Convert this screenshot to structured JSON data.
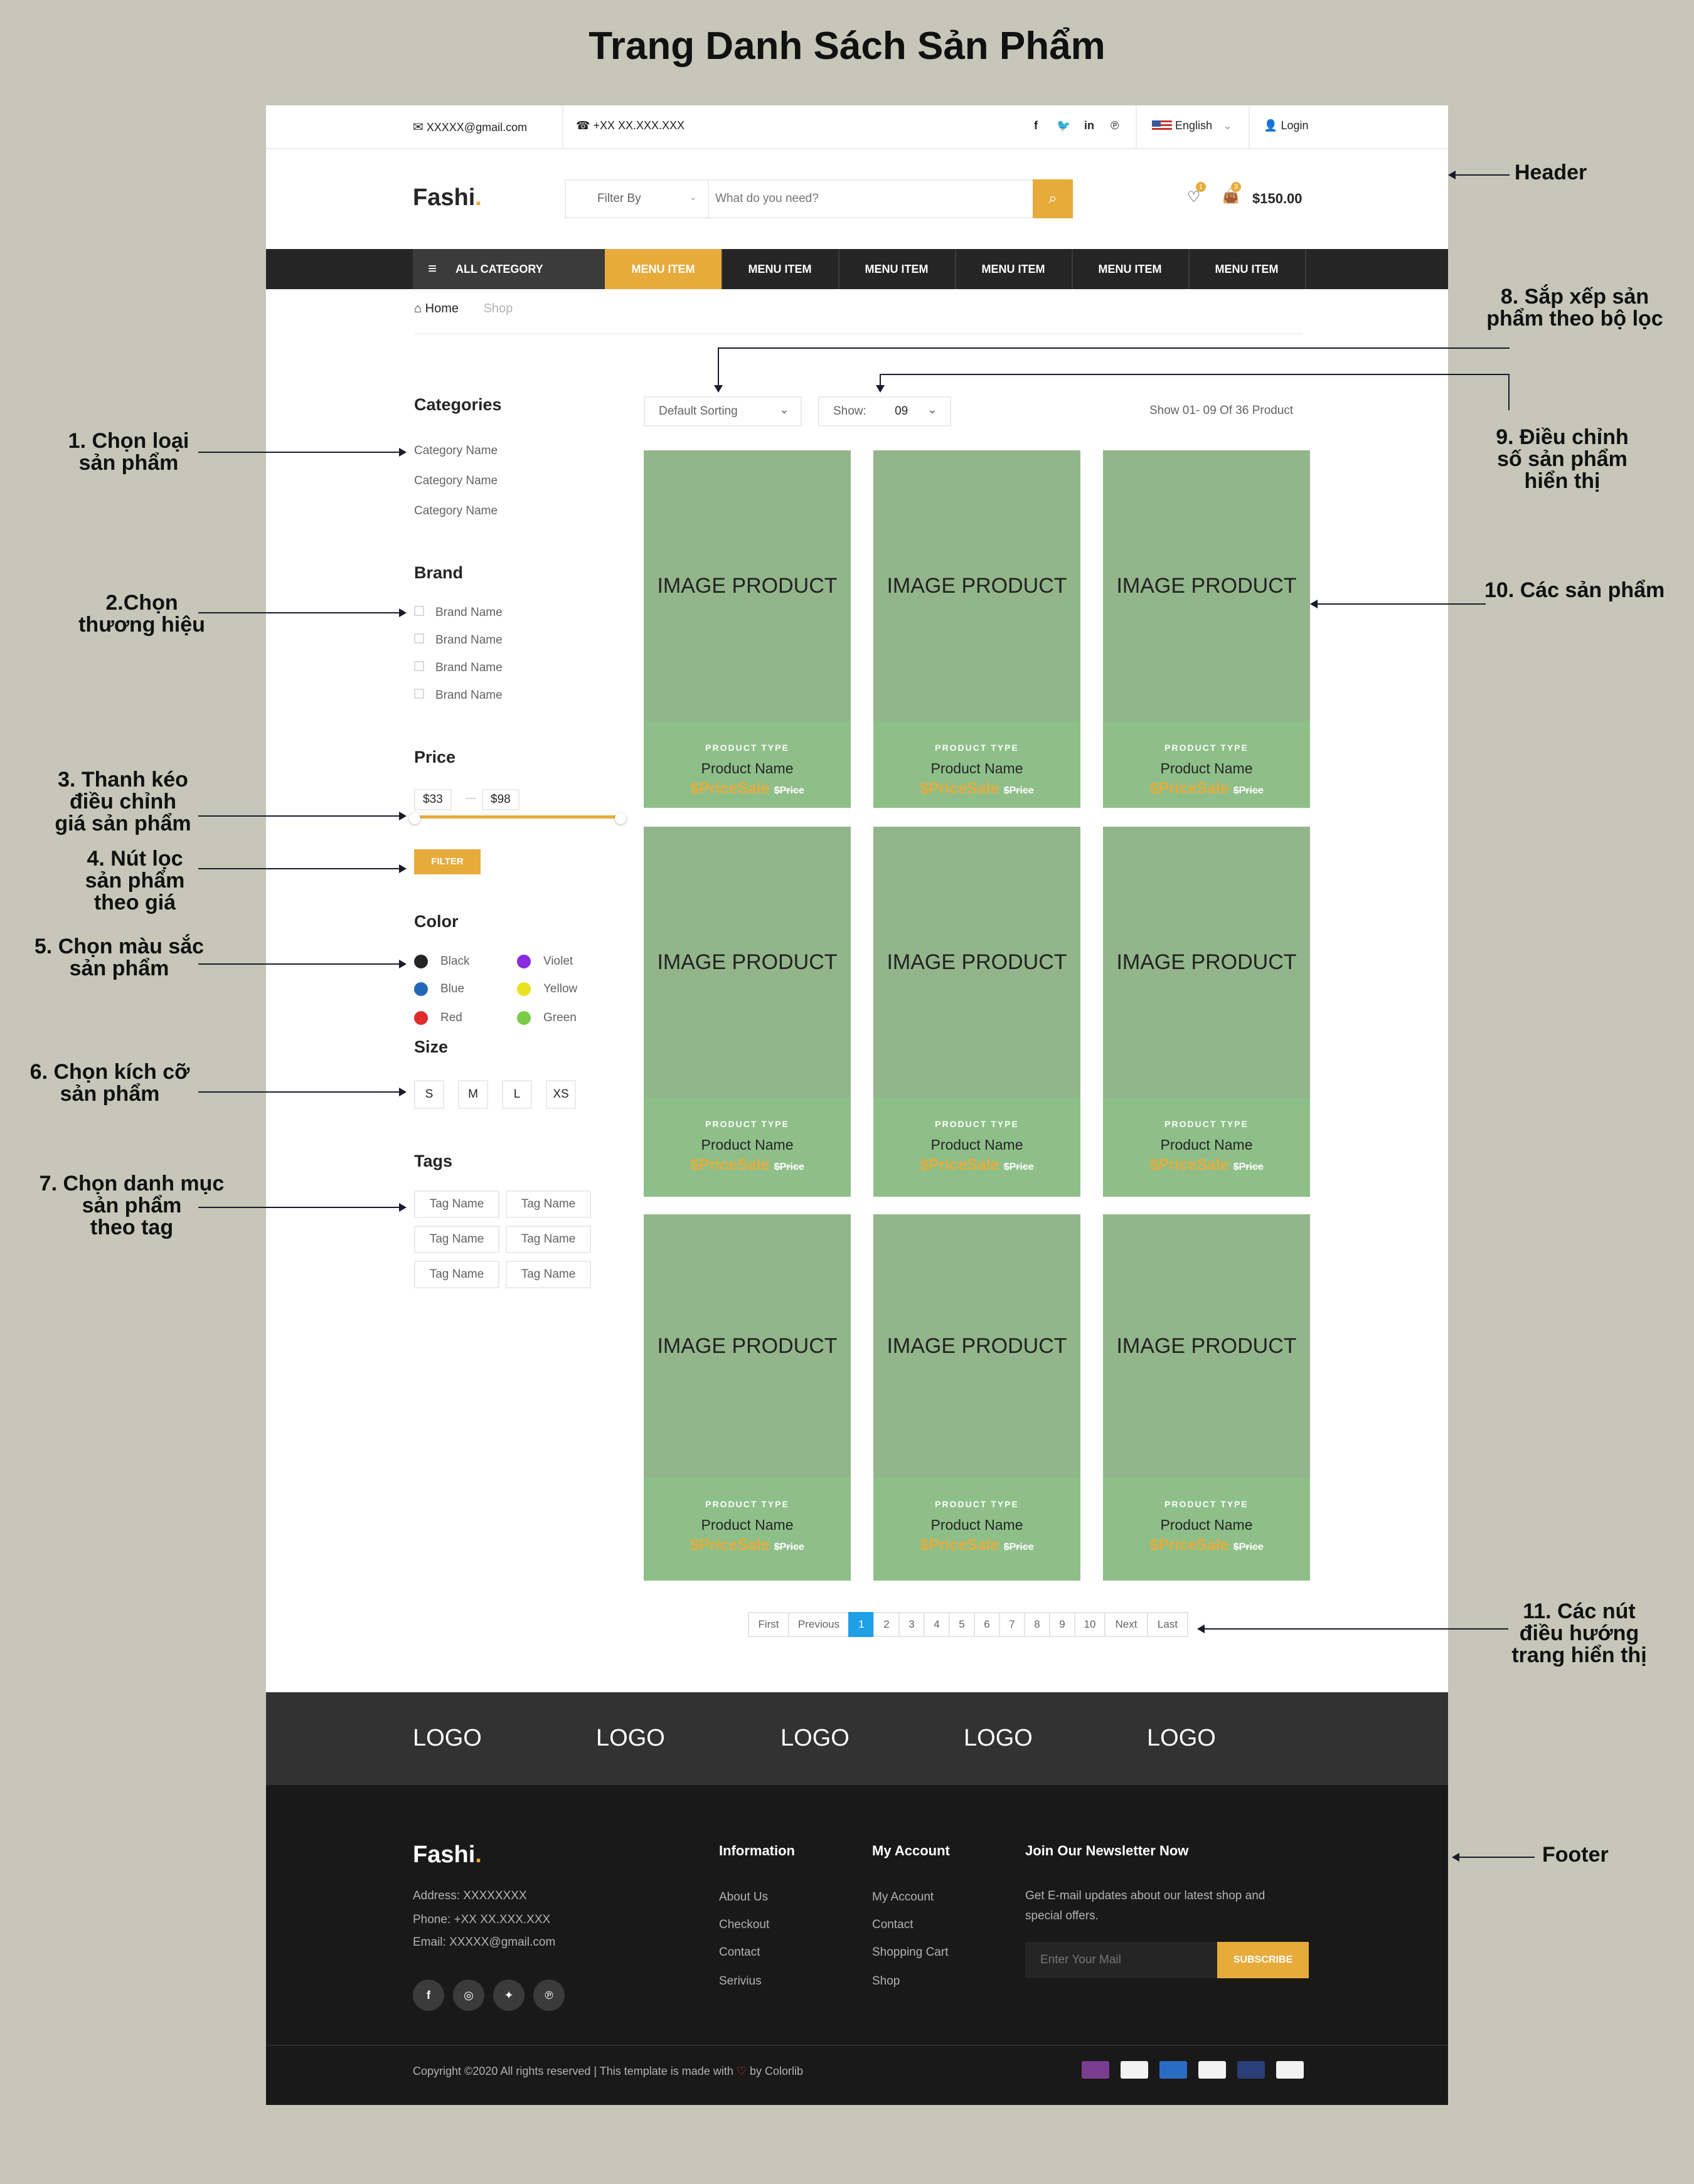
{
  "page_title": "Trang Danh Sách Sản Phẩm",
  "annotations": {
    "header": "Header",
    "filter_sort": [
      "8. Sắp xếp sản",
      "phẩm theo bộ lọc"
    ],
    "adjust_count": [
      "9. Điều chỉnh",
      "số sản phẩm",
      "hiển thị"
    ],
    "categories": [
      "1. Chọn loại",
      "sản phẩm"
    ],
    "brand": [
      "2.Chọn",
      "thương hiệu"
    ],
    "products": "10. Các sản phẩm",
    "price_slider": [
      "3. Thanh kéo",
      "điều chỉnh",
      "giá sản phẩm"
    ],
    "filter_button": [
      "4. Nút lọc",
      "sản phẩm",
      "theo giá"
    ],
    "color": [
      "5. Chọn màu sắc",
      "sản phẩm"
    ],
    "size": [
      "6. Chọn kích cỡ",
      "sản phẩm"
    ],
    "tags": [
      "7. Chọn danh mục",
      "sản phẩm",
      "theo tag"
    ],
    "pagination": [
      "11. Các nút",
      "điều hướng",
      "trang hiển thị"
    ],
    "footer": "Footer"
  },
  "topbar": {
    "email": "XXXXX@gmail.com",
    "phone": "+XX XX.XXX.XXX",
    "language": "English",
    "login": "Login"
  },
  "header": {
    "logo": "Fashi",
    "logo_dot": ".",
    "filter_label": "Filter By",
    "search_placeholder": "What do you need?",
    "wishlist_count": "1",
    "cart_count": "3",
    "cart_total": "$150.00"
  },
  "nav": {
    "all_category": "ALL CATEGORY",
    "items": [
      "MENU ITEM",
      "MENU ITEM",
      "MENU ITEM",
      "MENU ITEM",
      "MENU ITEM",
      "MENU ITEM"
    ]
  },
  "breadcrumb": {
    "home": "Home",
    "current": "Shop"
  },
  "sidebar": {
    "categories_title": "Categories",
    "categories": [
      "Category Name",
      "Category Name",
      "Category Name"
    ],
    "brand_title": "Brand",
    "brands": [
      "Brand Name",
      "Brand Name",
      "Brand Name",
      "Brand Name"
    ],
    "price_title": "Price",
    "price_min": "$33",
    "price_max": "$98",
    "filter_button": "FILTER",
    "color_title": "Color",
    "colors": [
      {
        "name": "Black",
        "hex": "#252525"
      },
      {
        "name": "Violet",
        "hex": "#8a2be2"
      },
      {
        "name": "Blue",
        "hex": "#2266b8"
      },
      {
        "name": "Yellow",
        "hex": "#e8e320"
      },
      {
        "name": "Red",
        "hex": "#e02b2b"
      },
      {
        "name": "Green",
        "hex": "#7acb48"
      }
    ],
    "size_title": "Size",
    "sizes": [
      "S",
      "M",
      "L",
      "XS"
    ],
    "tags_title": "Tags",
    "tags": [
      "Tag Name",
      "Tag Name",
      "Tag Name",
      "Tag Name",
      "Tag Name",
      "Tag Name"
    ]
  },
  "toolbar": {
    "sorting": "Default Sorting",
    "show_label": "Show:",
    "show_value": "09",
    "result_text": "Show 01- 09 Of 36 Product"
  },
  "products": [
    {
      "image": "IMAGE PRODUCT",
      "type": "PRODUCT TYPE",
      "name": "Product Name",
      "sale": "$PriceSale",
      "price": "$Price"
    },
    {
      "image": "IMAGE PRODUCT",
      "type": "PRODUCT TYPE",
      "name": "Product Name",
      "sale": "$PriceSale",
      "price": "$Price"
    },
    {
      "image": "IMAGE PRODUCT",
      "type": "PRODUCT TYPE",
      "name": "Product Name",
      "sale": "$PriceSale",
      "price": "$Price"
    },
    {
      "image": "IMAGE PRODUCT",
      "type": "PRODUCT TYPE",
      "name": "Product Name",
      "sale": "$PriceSale",
      "price": "$Price"
    },
    {
      "image": "IMAGE PRODUCT",
      "type": "PRODUCT TYPE",
      "name": "Product Name",
      "sale": "$PriceSale",
      "price": "$Price"
    },
    {
      "image": "IMAGE PRODUCT",
      "type": "PRODUCT TYPE",
      "name": "Product Name",
      "sale": "$PriceSale",
      "price": "$Price"
    },
    {
      "image": "IMAGE PRODUCT",
      "type": "PRODUCT TYPE",
      "name": "Product Name",
      "sale": "$PriceSale",
      "price": "$Price"
    },
    {
      "image": "IMAGE PRODUCT",
      "type": "PRODUCT TYPE",
      "name": "Product Name",
      "sale": "$PriceSale",
      "price": "$Price"
    },
    {
      "image": "IMAGE PRODUCT",
      "type": "PRODUCT TYPE",
      "name": "Product Name",
      "sale": "$PriceSale",
      "price": "$Price"
    }
  ],
  "pagination": [
    "First",
    "Previous",
    "1",
    "2",
    "3",
    "4",
    "5",
    "6",
    "7",
    "8",
    "9",
    "10",
    "Next",
    "Last"
  ],
  "pagination_active": "1",
  "partner_logos": [
    "LOGO",
    "LOGO",
    "LOGO",
    "LOGO",
    "LOGO"
  ],
  "footer": {
    "logo": "Fashi",
    "address": "Address: XXXXXXXX",
    "phone": "Phone: +XX XX.XXX.XXX",
    "email": "Email: XXXXX@gmail.com",
    "info_title": "Information",
    "info_links": [
      "About Us",
      "Checkout",
      "Contact",
      "Serivius"
    ],
    "account_title": "My Account",
    "account_links": [
      "My Account",
      "Contact",
      "Shopping Cart",
      "Shop"
    ],
    "newsletter_title": "Join Our Newsletter Now",
    "newsletter_text_1": "Get E-mail updates about our latest shop and",
    "newsletter_text_2": "special offers.",
    "newsletter_placeholder": "Enter Your Mail",
    "subscribe": "SUBSCRIBE",
    "copyright_1": "Copyright ©2020 All rights reserved | This template is made with",
    "copyright_2": "by Colorlib",
    "payments": [
      "Skrill",
      "Bitcoin",
      "AmEx",
      "PayPal",
      "MasterCard",
      "VISA"
    ]
  },
  "colors": {
    "accent": "#e7ab3c",
    "dark": "#252525",
    "product_bg": "#93b58b",
    "pagination_active": "#1ea0e6"
  }
}
